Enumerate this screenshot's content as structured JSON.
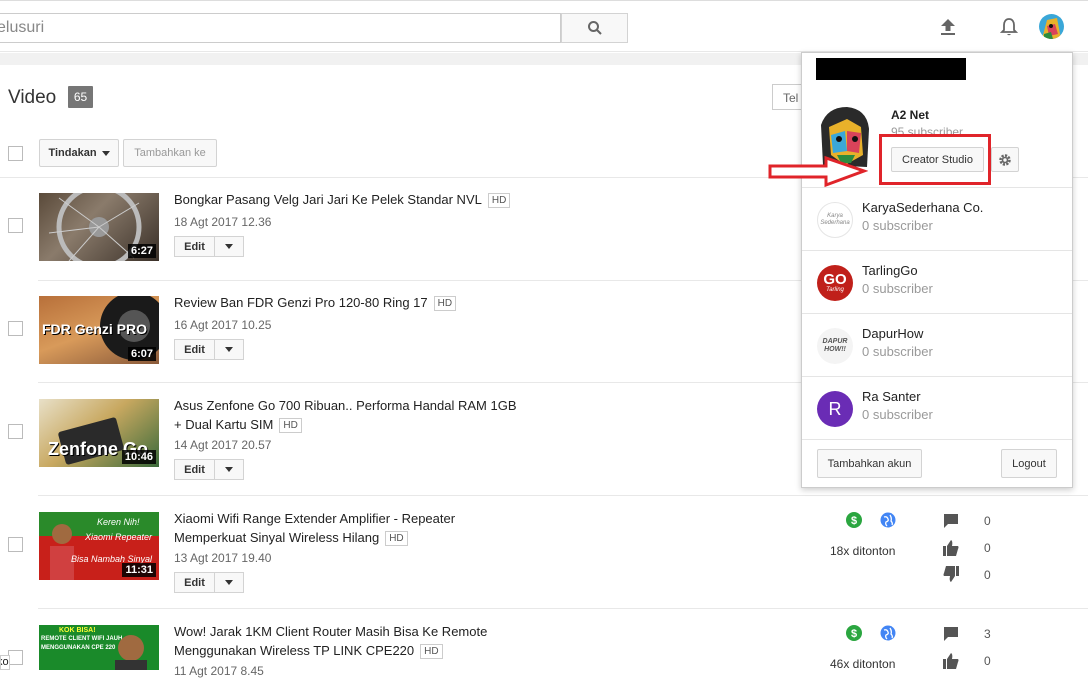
{
  "topbar": {
    "search_placeholder": "elusuri",
    "search_icon": "search-icon",
    "upload_icon": "upload-icon",
    "bell_icon": "bell-icon"
  },
  "toolbar": {
    "section_title": "Video",
    "video_count": "65",
    "filter_text": "Tel",
    "actions_label": "Tindakan",
    "add_to_label": "Tambahkan ke"
  },
  "videos": [
    {
      "title": "Bongkar Pasang Velg Jari Jari Ke Pelek Standar NVL",
      "hd": "HD",
      "date": "18 Agt 2017 12.36",
      "duration": "6:27",
      "edit": "Edit"
    },
    {
      "title": "Review Ban FDR Genzi Pro 120-80 Ring 17",
      "hd": "HD",
      "date": "16 Agt 2017 10.25",
      "duration": "6:07",
      "edit": "Edit",
      "thumb_text": "FDR Genzi PRO"
    },
    {
      "title_line1": "Asus Zenfone Go 700 Ribuan.. Performa Handal RAM 1GB",
      "title_line2": "+ Dual Kartu SIM",
      "hd": "HD",
      "date": "14 Agt 2017 20.57",
      "duration": "10:46",
      "edit": "Edit",
      "thumb_text": "Zenfone Go"
    },
    {
      "title_line1": "Xiaomi Wifi Range Extender Amplifier - Repeater",
      "title_line2": "Memperkuat Sinyal Wireless Hilang",
      "hd": "HD",
      "date": "13 Agt 2017 19.40",
      "duration": "11:31",
      "edit": "Edit",
      "views": "18x ditonton",
      "comments": "0",
      "likes": "0",
      "dislikes": "0",
      "thumb_text1": "Keren Nih!",
      "thumb_text2": "Xiaomi Repeater",
      "thumb_text3": "Bisa Nambah Sinyal"
    },
    {
      "title_line1": "Wow! Jarak 1KM Client Router Masih Bisa Ke Remote",
      "title_line2": "Menggunakan Wireless TP LINK CPE220",
      "hd": "HD",
      "date": "11 Agt 2017 8.45",
      "views": "46x ditonton",
      "comments": "3",
      "likes": "0",
      "thumb_text1": "KOK BISA!",
      "thumb_text2": "REMOTE CLIENT WIFI JAUH",
      "thumb_text3": "MENGGUNAKAN CPE 220"
    }
  ],
  "popup": {
    "channel_name": "A2 Net",
    "channel_subs": "95 subscriber",
    "creator_studio": "Creator Studio",
    "accounts": [
      {
        "name": "KaryaSederhana Co.",
        "subs": "0 subscriber",
        "avatar_text": "Karya Sederhana"
      },
      {
        "name": "TarlingGo",
        "subs": "0 subscriber",
        "avatar_text": "GO",
        "avatar_sub": "Tarling"
      },
      {
        "name": "DapurHow",
        "subs": "0 subscriber",
        "avatar_text": "DAPUR HOW!!"
      },
      {
        "name": "Ra Santer",
        "subs": "0 subscriber",
        "avatar_text": "R"
      }
    ],
    "add_account": "Tambahkan akun",
    "logout": "Logout"
  },
  "bottom_left": "ko",
  "colors": {
    "annotation_red": "#e0242a",
    "monetize_green": "#2ba640",
    "public_blue": "#4285f4",
    "ra_purple": "#6a2cb5",
    "tarling_red": "#c0201a"
  }
}
